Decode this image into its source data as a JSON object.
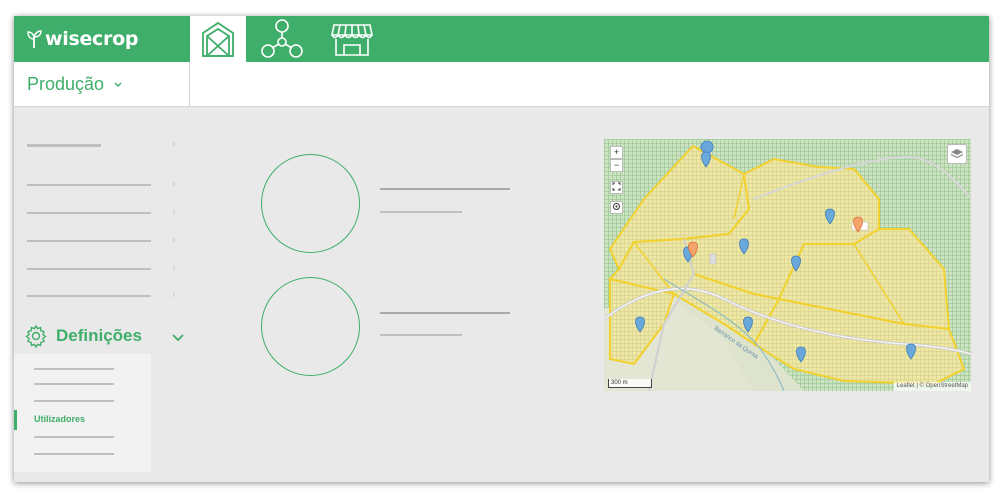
{
  "app": {
    "logo_text": "wisecrop",
    "brand_color": "#3fae6a"
  },
  "topnav": {
    "items": [
      {
        "icon": "greenhouse-icon",
        "active": true
      },
      {
        "icon": "network-icon",
        "active": false
      },
      {
        "icon": "market-stall-icon",
        "active": false
      }
    ]
  },
  "module": {
    "label": "Produção",
    "icon": "chevron-down-icon"
  },
  "sidebar": {
    "settings_label": "Definições",
    "settings_icon": "gear-icon",
    "settings_chevron": "chevron-down-icon",
    "active_subitem": "Utilizadores"
  },
  "map": {
    "zoom_in": "+",
    "zoom_out": "−",
    "scale_label": "300 m",
    "attribution": "Leaflet | © OpenStreetMap",
    "road_label": "Barranco da Quinta"
  }
}
